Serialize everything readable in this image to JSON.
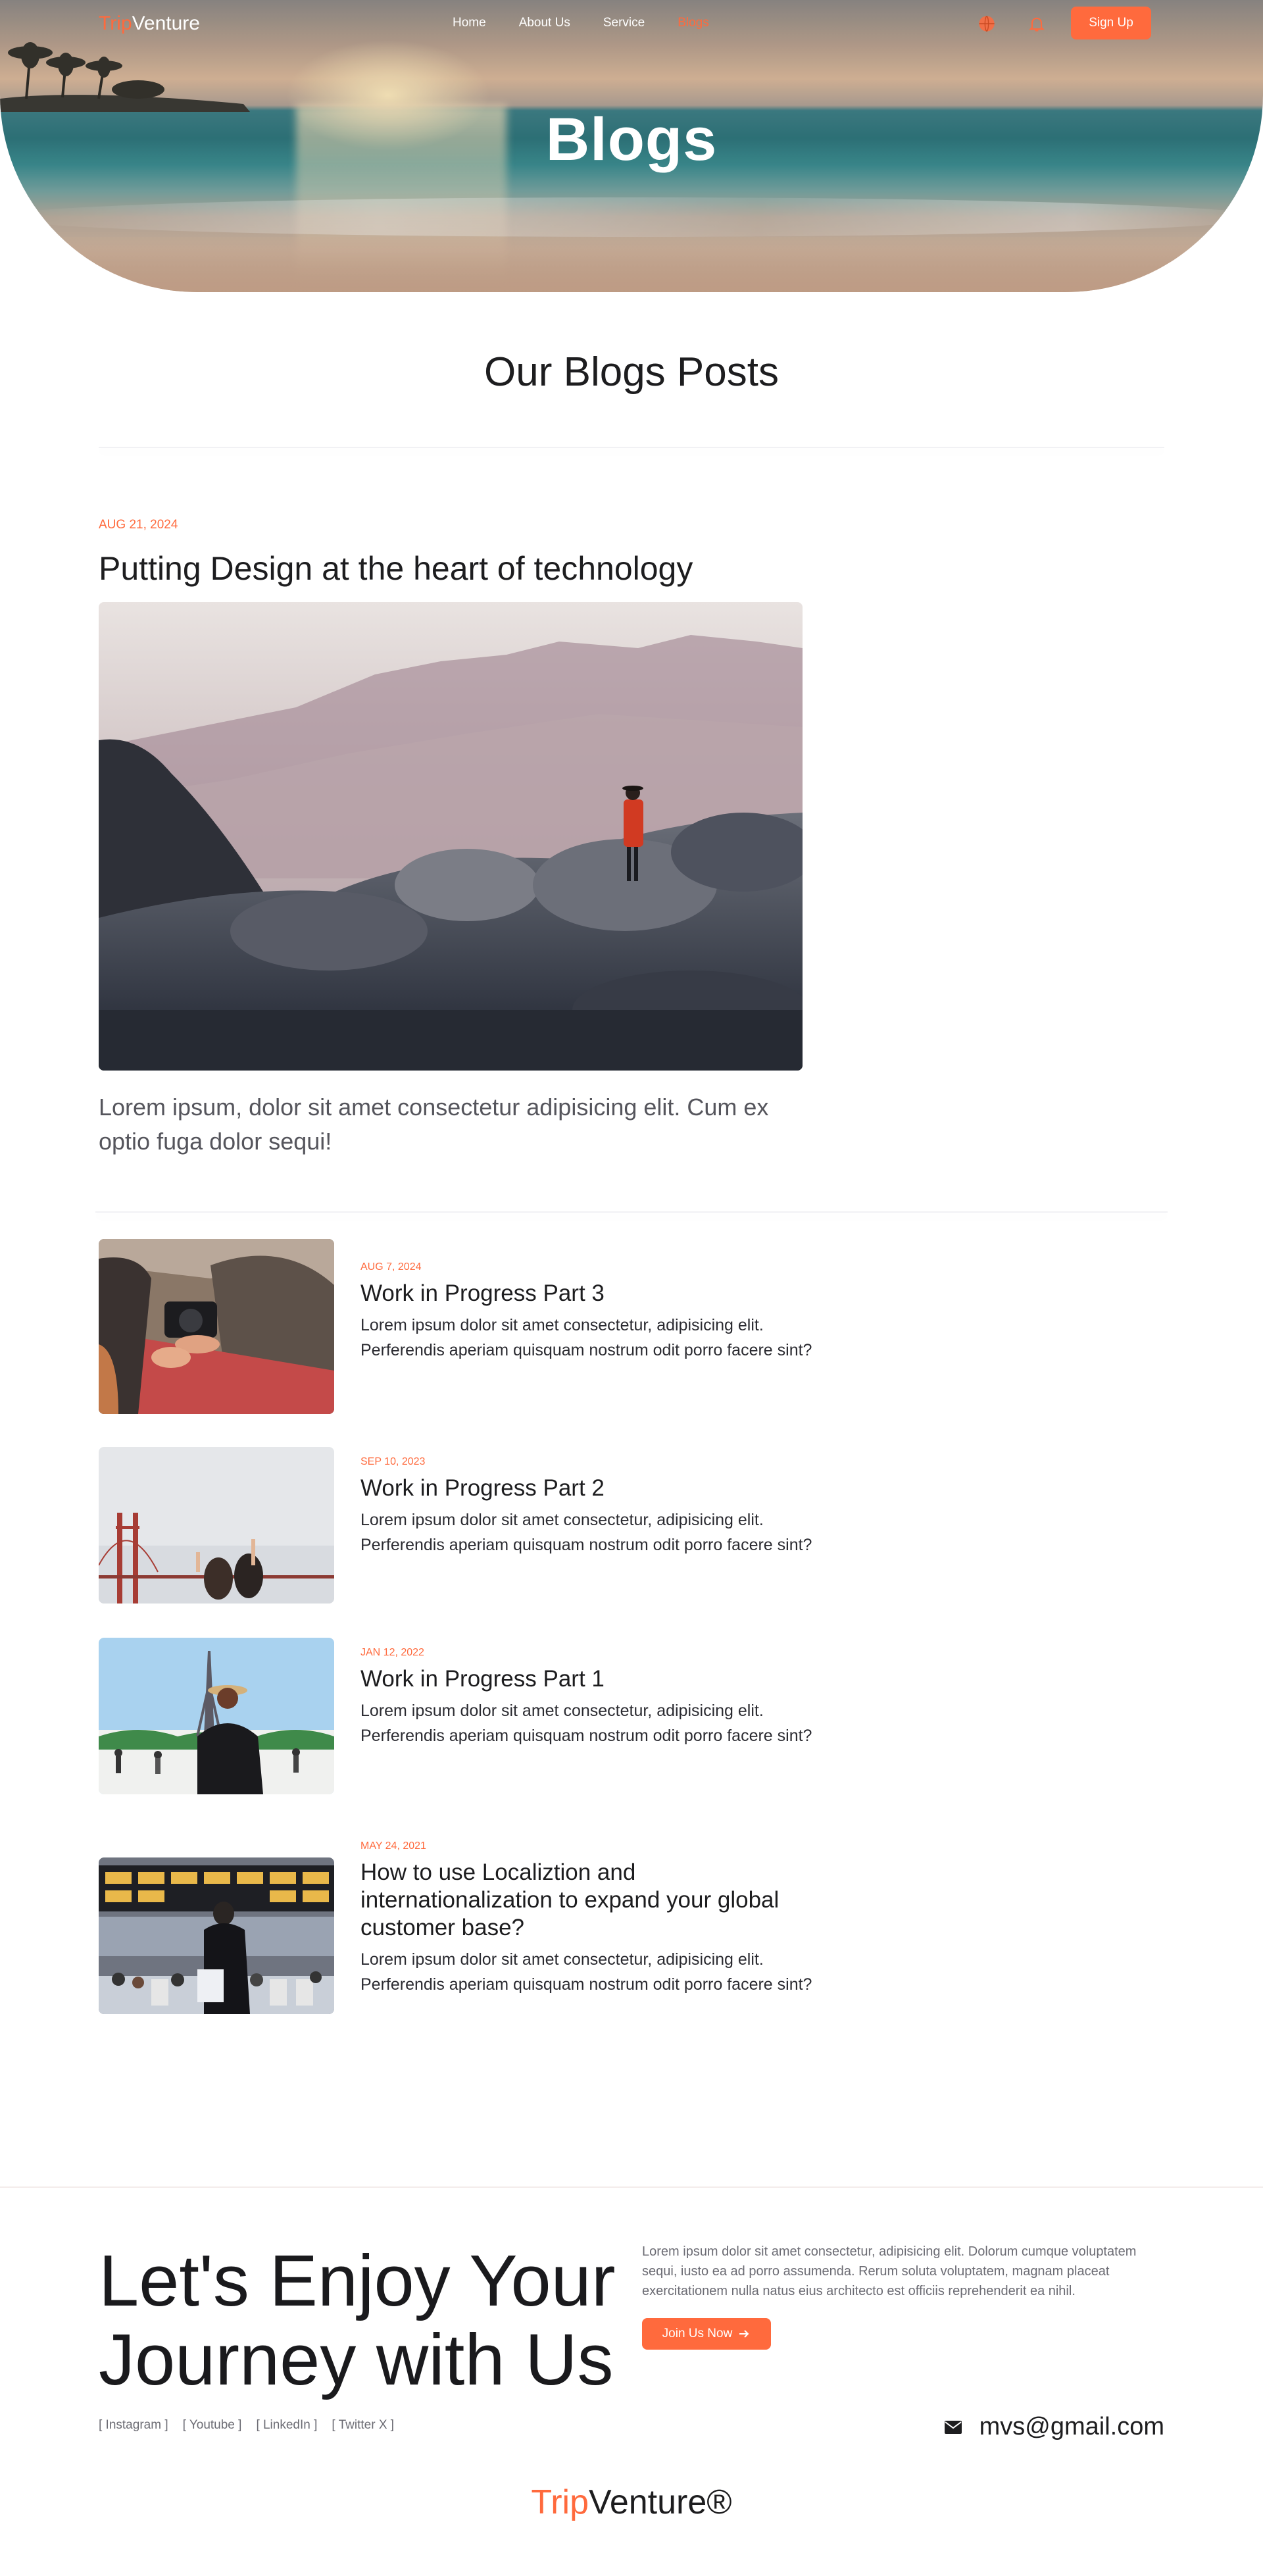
{
  "nav": {
    "logo_accent": "Trip",
    "logo_rest": "Venture",
    "links": [
      {
        "label": "Home"
      },
      {
        "label": "About Us"
      },
      {
        "label": "Service"
      },
      {
        "label": "Blogs",
        "active": true
      }
    ],
    "icons": [
      "globe-icon",
      "bell-icon"
    ],
    "signup_label": "Sign Up"
  },
  "hero": {
    "title": "Blogs"
  },
  "section": {
    "title": "Our Blogs Posts"
  },
  "featured": {
    "date": "AUG 21, 2024",
    "title": "Putting Design at the heart of technology",
    "excerpt": "Lorem ipsum, dolor sit amet consectetur adipisicing elit. Cum ex optio fuga dolor sequi!"
  },
  "posts": [
    {
      "date": "AUG 7, 2024",
      "title": "Work in Progress Part 3",
      "excerpt": "Lorem ipsum dolor sit amet consectetur, adipisicing elit. Perferendis aperiam quisquam nostrum odit porro facere sint?"
    },
    {
      "date": "SEP 10, 2023",
      "title": "Work in Progress Part 2",
      "excerpt": "Lorem ipsum dolor sit amet consectetur, adipisicing elit. Perferendis aperiam quisquam nostrum odit porro facere sint?"
    },
    {
      "date": "JAN 12, 2022",
      "title": "Work in Progress Part 1",
      "excerpt": "Lorem ipsum dolor sit amet consectetur, adipisicing elit. Perferendis aperiam quisquam nostrum odit porro facere sint?"
    },
    {
      "date": "MAY 24, 2021",
      "title": "How to use Localiztion and internationalization to expand your global customer base?",
      "excerpt": "Lorem ipsum dolor sit amet consectetur, adipisicing elit. Perferendis aperiam quisquam nostrum odit porro facere sint?"
    }
  ],
  "footer": {
    "headline_line1": "Let's Enjoy Your",
    "headline_line2": "Journey with Us",
    "text": "Lorem ipsum dolor sit amet consectetur, adipisicing elit. Dolorum cumque voluptatem sequi, iusto ea ad porro assumenda. Rerum soluta voluptatem, magnam placeat exercitationem nulla natus eius architecto est officiis reprehenderit ea nihil.",
    "join_label": "Join Us Now",
    "socials": [
      "[ Instagram ]",
      "[ Youtube ]",
      "[ LinkedIn ]",
      "[ Twitter X ]"
    ],
    "email": "mvs@gmail.com",
    "logo_accent": "Trip",
    "logo_rest": "Venture®"
  },
  "colors": {
    "accent": "#ff6a3d",
    "text": "#1d1d1f",
    "muted": "#6b6b73"
  }
}
